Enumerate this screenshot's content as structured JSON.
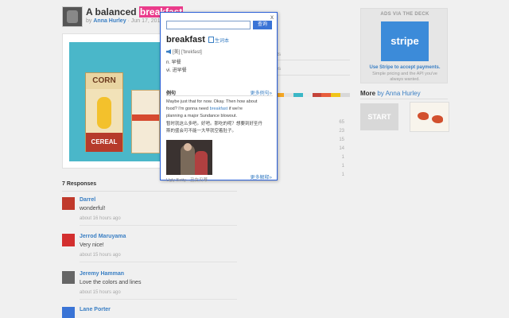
{
  "shot": {
    "title_prefix": "A balanced",
    "title_highlight": "breakfast",
    "by": "by",
    "author": "Anna Hurley",
    "date": "Jun 17, 2013",
    "art": {
      "corn_top": "CORN",
      "corn_bottom": "CEREAL"
    }
  },
  "dictionary": {
    "search_button": "查询",
    "word": "breakfast",
    "vocab": "生词本",
    "phonetic": "[美] ['brekfəst]",
    "defs": [
      "n. 早餐",
      "vi. 进早餐"
    ],
    "examples_label": "例句",
    "more_examples": "更多例句»",
    "example_en": [
      "Maybe just that for now. Okay. Then how about",
      "food? I'm gonna need",
      "breakfast",
      "if we're",
      "planning a major Sundance blowout."
    ],
    "example_zh": [
      "暂时就这么多吧。好吧。那吃的呢？想要到好圣丹",
      "斯的盛会可不能一大早就空着肚子。"
    ],
    "caption": "Ugly Betty - 丑女贝蒂",
    "more_defs": "更多解释»",
    "close": "x"
  },
  "middle": {
    "labels": [
      "ets",
      "tes"
    ],
    "palette": [
      "#f5a623",
      "#e2e2e2",
      "#3bb7c6",
      "#ededed",
      "#c4443a",
      "#e85d3c",
      "#f0c419",
      "#d8d8d8"
    ],
    "stats": [
      "65",
      "23",
      "15",
      "14",
      "1",
      "1",
      "1"
    ]
  },
  "sidebar": {
    "ad_label": "ADS VIA THE DECK",
    "stripe": "stripe",
    "ad_link": "Use Stripe to accept payments.",
    "ad_text_1": "Simple pricing and the API you've",
    "ad_text_2": "always wanted.",
    "more_label": "More",
    "more_by": "by Anna Hurley",
    "start": "START"
  },
  "responses": {
    "title": "7 Responses",
    "items": [
      {
        "name": "Darrel",
        "text": "wonderful!",
        "time": "about 16 hours ago",
        "color": "#c0392b"
      },
      {
        "name": "Jerrod Maruyama",
        "text": "Very nice!",
        "time": "about 15 hours ago",
        "color": "#d32f2f"
      },
      {
        "name": "Jeremy Hamman",
        "text": "Love the colors and lines",
        "time": "about 15 hours ago",
        "color": "#666666"
      },
      {
        "name": "Lane Porter",
        "text": "",
        "time": "",
        "color": "#3a74d6"
      }
    ]
  }
}
